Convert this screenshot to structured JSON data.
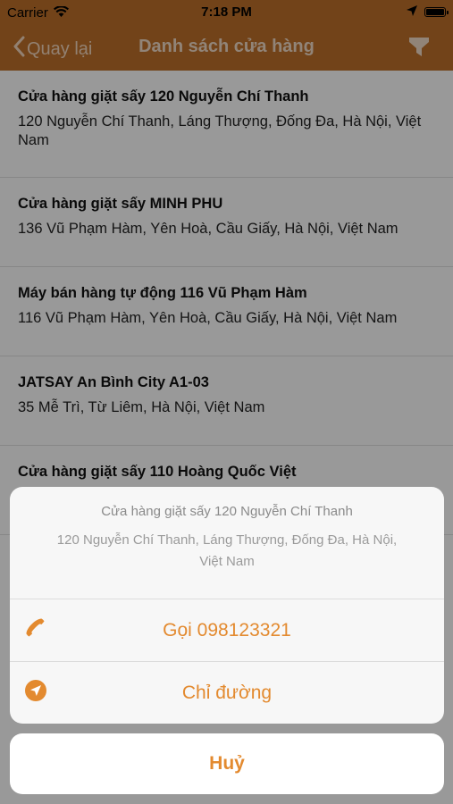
{
  "status_bar": {
    "carrier": "Carrier",
    "time": "7:18 PM"
  },
  "nav": {
    "back_label": "Quay lại",
    "title": "Danh sách cửa hàng"
  },
  "stores": [
    {
      "name": "Cửa hàng giặt sấy 120 Nguyễn Chí Thanh",
      "address": "120 Nguyễn Chí Thanh, Láng Thượng, Đống Đa, Hà Nội, Việt Nam"
    },
    {
      "name": "Cửa hàng giặt sấy MINH PHU",
      "address": "136 Vũ Phạm Hàm, Yên Hoà, Cầu Giấy, Hà Nội, Việt Nam"
    },
    {
      "name": "Máy bán hàng tự động 116 Vũ Phạm Hàm",
      "address": "116 Vũ Phạm Hàm, Yên Hoà, Cầu Giấy, Hà Nội, Việt Nam"
    },
    {
      "name": "JATSAY An Bình City A1-03",
      "address": "35 Mễ Trì, Từ Liêm, Hà Nội, Việt Nam"
    },
    {
      "name": "Cửa hàng giặt sấy 110 Hoàng Quốc Việt",
      "address": ""
    }
  ],
  "action_sheet": {
    "title": "Cửa hàng giặt sấy 120 Nguyễn Chí Thanh",
    "message_line1": "120 Nguyễn Chí Thanh, Láng Thượng, Đống Đa, Hà Nội,",
    "message_line2": "Việt Nam",
    "call_label": "Gọi 098123321",
    "directions_label": "Chỉ đường",
    "cancel_label": "Huỷ"
  },
  "colors": {
    "nav_bg": "#bf712a",
    "accent": "#e38a2f"
  },
  "icons": {
    "wifi": "wifi-icon",
    "location": "location-arrow-icon",
    "battery": "battery-icon",
    "back": "chevron-left-icon",
    "filter": "funnel-icon",
    "phone": "phone-icon",
    "navigate": "navigation-icon"
  }
}
